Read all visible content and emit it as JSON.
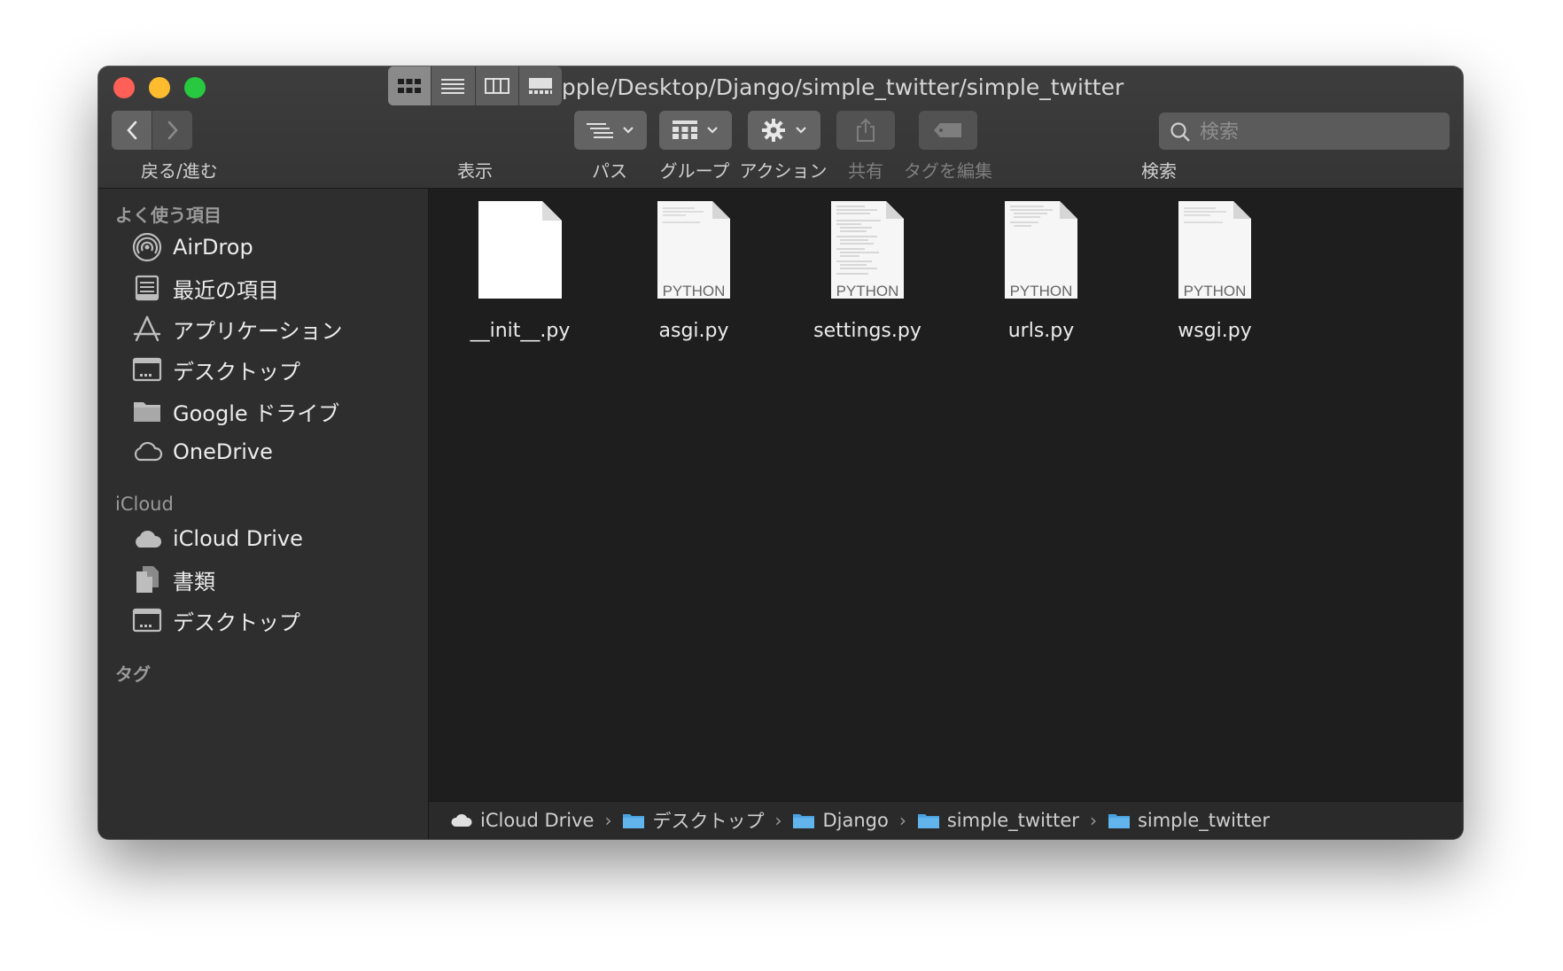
{
  "window": {
    "title": "/Users/apple/Desktop/Django/simple_twitter/simple_twitter",
    "title_icon": "folder-icon"
  },
  "toolbar": {
    "back_forward_label": "戻る/進む",
    "view_label": "表示",
    "path_label": "パス",
    "group_label": "グループ",
    "action_label": "アクション",
    "share_label": "共有",
    "edit_tags_label": "タグを編集",
    "search_label": "検索",
    "search_placeholder": "検索"
  },
  "sidebar": {
    "favorites_heading": "よく使う項目",
    "favorites": [
      {
        "label": "AirDrop",
        "icon": "airdrop-icon"
      },
      {
        "label": "最近の項目",
        "icon": "recents-icon"
      },
      {
        "label": "アプリケーション",
        "icon": "applications-icon"
      },
      {
        "label": "デスクトップ",
        "icon": "desktop-icon"
      },
      {
        "label": "Google ドライブ",
        "icon": "folder-icon"
      },
      {
        "label": "OneDrive",
        "icon": "cloud-icon"
      }
    ],
    "icloud_heading": "iCloud",
    "icloud": [
      {
        "label": "iCloud Drive",
        "icon": "icloud-icon"
      },
      {
        "label": "書類",
        "icon": "documents-icon"
      },
      {
        "label": "デスクトップ",
        "icon": "desktop-icon"
      }
    ],
    "tags_heading": "タグ"
  },
  "files": [
    {
      "name": "__init__.py",
      "kind": ""
    },
    {
      "name": "asgi.py",
      "kind": "PYTHON"
    },
    {
      "name": "settings.py",
      "kind": "PYTHON"
    },
    {
      "name": "urls.py",
      "kind": "PYTHON"
    },
    {
      "name": "wsgi.py",
      "kind": "PYTHON"
    }
  ],
  "pathbar": [
    {
      "label": "iCloud Drive",
      "icon": "cloud-icon"
    },
    {
      "label": "デスクトップ",
      "icon": "folder-icon"
    },
    {
      "label": "Django",
      "icon": "folder-icon"
    },
    {
      "label": "simple_twitter",
      "icon": "folder-icon"
    },
    {
      "label": "simple_twitter",
      "icon": "folder-icon"
    }
  ],
  "colors": {
    "accent_folder": "#4aa3e0",
    "close": "#fe5f57",
    "minimize": "#febc2e",
    "maximize": "#28c840"
  }
}
